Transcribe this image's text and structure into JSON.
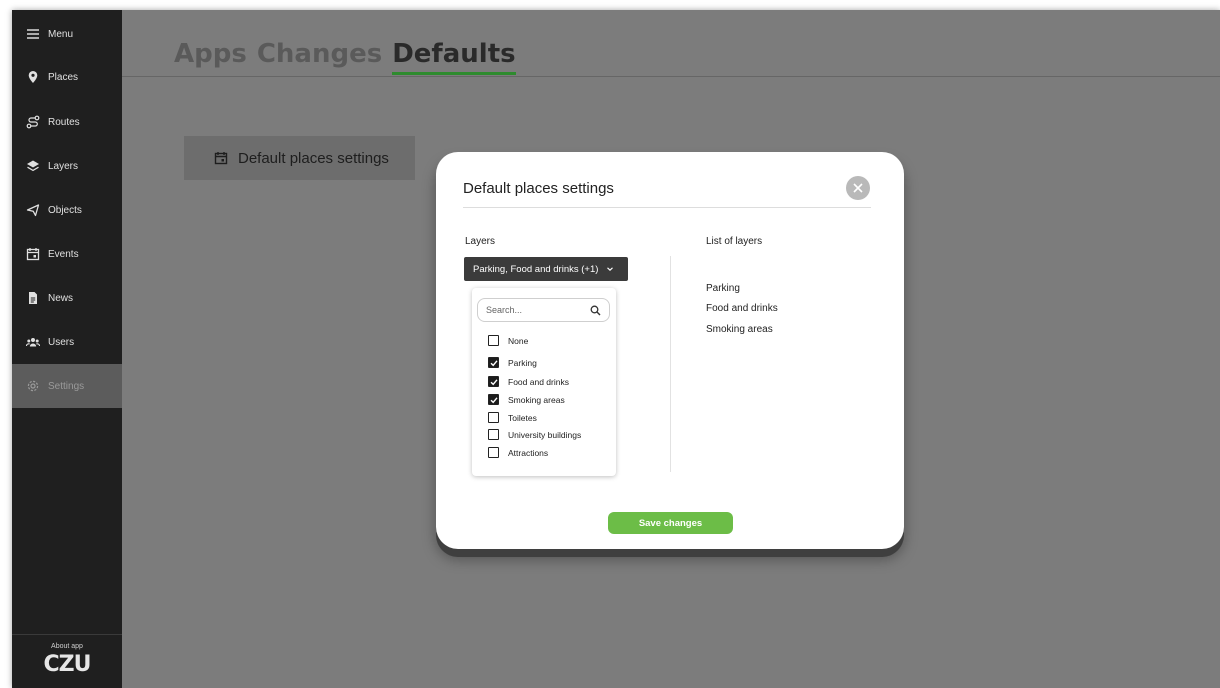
{
  "sidebar": {
    "menu_label": "Menu",
    "items": [
      {
        "label": "Places",
        "icon": "pin-icon"
      },
      {
        "label": "Routes",
        "icon": "route-icon"
      },
      {
        "label": "Layers",
        "icon": "layers-icon"
      },
      {
        "label": "Objects",
        "icon": "objects-icon"
      },
      {
        "label": "Events",
        "icon": "calendar-icon"
      },
      {
        "label": "News",
        "icon": "document-icon"
      },
      {
        "label": "Users",
        "icon": "users-icon"
      },
      {
        "label": "Settings",
        "icon": "gear-icon",
        "active": true
      }
    ],
    "about_label": "About app",
    "logo_text": "CZU"
  },
  "header": {
    "tabs": [
      {
        "label": "Apps"
      },
      {
        "label": "Changes"
      },
      {
        "label": "Defaults",
        "active": true
      }
    ]
  },
  "card": {
    "label": "Default places settings"
  },
  "modal": {
    "title": "Default places settings",
    "layers_title": "Layers",
    "list_title": "List of layers",
    "select_value": "Parking, Food and drinks (+1)",
    "search_placeholder": "Search...",
    "options": [
      {
        "label": "None",
        "checked": false
      },
      {
        "label": "Parking",
        "checked": true
      },
      {
        "label": "Food and drinks",
        "checked": true
      },
      {
        "label": "Smoking areas",
        "checked": true
      },
      {
        "label": "Toiletes",
        "checked": false
      },
      {
        "label": "University buildings",
        "checked": false
      },
      {
        "label": "Attractions",
        "checked": false
      }
    ],
    "list_items": [
      "Parking",
      "Food and drinks",
      "Smoking areas"
    ],
    "save_label": "Save changes"
  },
  "colors": {
    "accent_green": "#6cbd47",
    "tab_underline": "#2e8b2e",
    "sidebar_bg": "#1f1f1f"
  }
}
